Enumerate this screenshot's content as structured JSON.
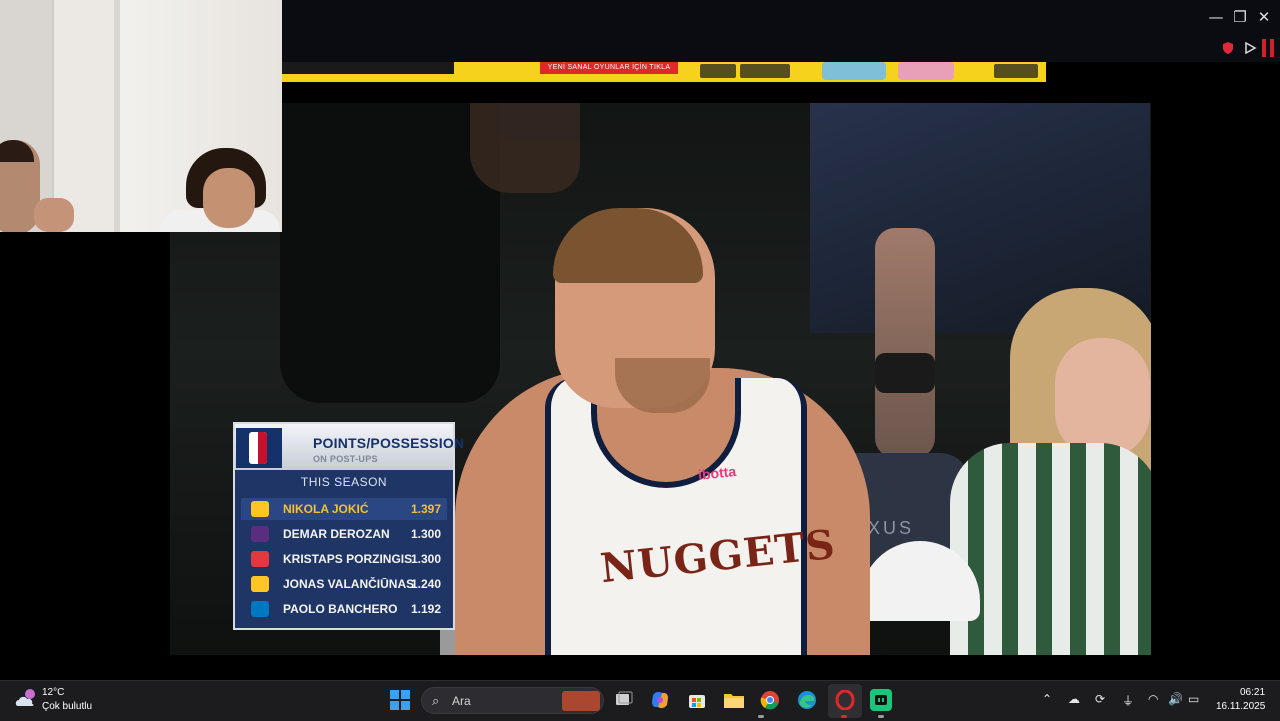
{
  "window": {
    "minimize": "—",
    "restore": "❐",
    "close": "✕"
  },
  "ad_banner": {
    "cta_text": "YENİ SANAL OYUNLAR İÇİN TIKLA"
  },
  "video": {
    "jersey_text": "NUGGETS",
    "sponsor": "ibotta",
    "arena_sign": "LEXUS",
    "overlay": {
      "title": "POINTS/POSSESSION",
      "subtitle": "ON POST-UPS",
      "period": "THIS SEASON",
      "rows": [
        {
          "name": "NIKOLA JOKIĆ",
          "value": "1.397",
          "team_color": "#fec524"
        },
        {
          "name": "DEMAR DEROZAN",
          "value": "1.300",
          "team_color": "#5a2d81"
        },
        {
          "name": "KRISTAPS PORZINGIS",
          "value": "1.300",
          "team_color": "#e03a3e"
        },
        {
          "name": "JONAS VALANČIŪNAS",
          "value": "1.240",
          "team_color": "#fec524"
        },
        {
          "name": "PAOLO BANCHERO",
          "value": "1.192",
          "team_color": "#0077c0"
        }
      ]
    }
  },
  "taskbar": {
    "weather": {
      "temp": "12°C",
      "desc": "Çok bulutlu",
      "badge": "2"
    },
    "search_placeholder": "Ara",
    "clock": {
      "time": "06:21",
      "date": "16.11.2025"
    },
    "colors": {
      "accent": "#3aa0f0",
      "active_app": "#e0282a"
    }
  }
}
